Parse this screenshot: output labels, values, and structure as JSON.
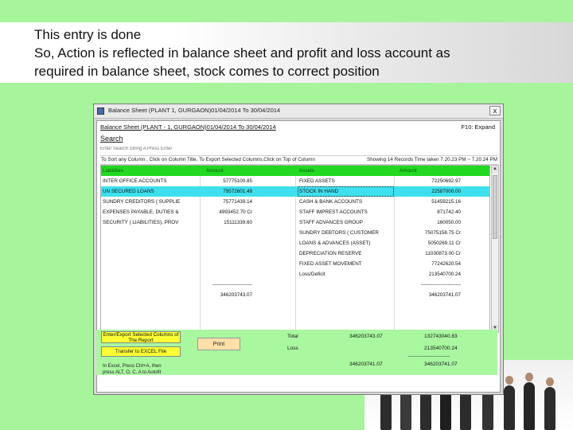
{
  "caption": {
    "line1": "This entry is done",
    "line2": "So,  Action is reflected in balance sheet and profit and loss account as",
    "line3": "required in balance sheet,  stock comes to correct position"
  },
  "window": {
    "title": "Balance Sheet (PLANT   1, GURGAON)01/04/2014 To 30/04/2014",
    "close_label": "x",
    "header_title": "Balance Sheet (PLANT - 1, GURGAON)01/04/2014 To 30/04/2014",
    "expand_hint": "F10: Expand",
    "search_label": "Search",
    "search_placeholder": "Enter Search String A Press Enter",
    "info_left": "To Sort any Column , Click on Column Title, To Export Selected Columns,Click on Top of Column",
    "info_right": "Showing 14 Records Time taken 7.20.23 PM  ~ 7.20.24 PM"
  },
  "grid": {
    "headers": [
      "Liabilities",
      "Amount",
      "Assets",
      "Amount"
    ],
    "rows": [
      [
        "INTER OFFICE ACCOUNTS",
        "57775100.85",
        "FIXED ASSETS",
        "72250692.97"
      ],
      [
        "UN SECURED LOANS",
        "79572601.48",
        "STOCK IN HAND",
        "22587000.00"
      ],
      [
        "SUNDRY CREDITORS ( SUPPLIE",
        "75771439.14",
        "CASH & BANK ACCOUNTS",
        "51459215.16"
      ],
      [
        "EXPENSES PAYABLE, DUTIES &",
        "4993452.70 Cr",
        "STAFF IMPREST ACCOUNTS",
        "871742.40"
      ],
      [
        "SECURITY ( LIABILITIES), PROV",
        "15111339.60",
        "STAFF ADVANCES GROUP",
        "160050.00"
      ],
      [
        "",
        "",
        "SUNDRY DEBTORS ( CUSTOMER",
        "75075158.75 Cr"
      ],
      [
        "",
        "",
        "LOANS & ADVANCES (ASSET)",
        "5050269.11 Cr"
      ],
      [
        "",
        "",
        "DEPRECIATION RESERVE",
        "11030873.00 Cr"
      ],
      [
        "",
        "",
        "FIXED ASSET MOVEMENT",
        "77242620.54"
      ],
      [
        "",
        "",
        "Loss/Deficit",
        "213540700.24"
      ],
      [
        "",
        "------------------------",
        "",
        "------------------------"
      ],
      [
        "",
        "346203743.07",
        "",
        "346203741.07"
      ]
    ]
  },
  "scroll": {
    "up": "▲",
    "down": "▼"
  },
  "bottom": {
    "export_button": "Enter/Export Selected Columns of The Report",
    "transfer_button": "Transfer to EXCEL File",
    "print_button": "Print",
    "hint": "In Excel, Press Ctrl+A, then\npress ALT, O, C, A to Autofit",
    "total_label": "Total",
    "total_left": "346203743.07",
    "total_right": "132743040.83",
    "loss_label": "Loss",
    "loss_value": "213540700.24",
    "dashes": "------------------------",
    "grand_left": "346203741.07",
    "grand_right": "346203741.07"
  },
  "colors": {
    "background": "#a6f59a",
    "header_green": "#22d922",
    "selected_row": "#3fe0ee",
    "button_yellow": "#ffff33"
  }
}
